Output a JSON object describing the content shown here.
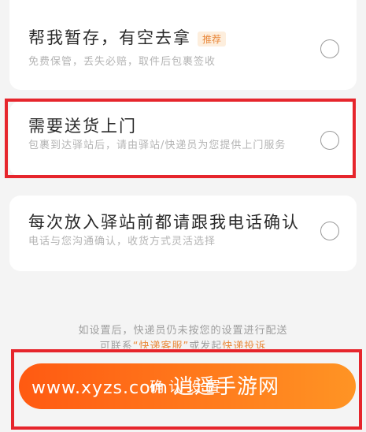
{
  "options": [
    {
      "title": "帮我暂存，有空去拿",
      "tag": "推荐",
      "desc": "免费保管，丢失必赔，取件后包裹签收",
      "selected": false
    },
    {
      "title": "需要送货上门",
      "desc": "包裹到达驿站后，请由驿站/快递员为您提供上门服务",
      "selected": false
    },
    {
      "title": "每次放入驿站前都请跟我电话确认",
      "desc": "电话与您沟通确认，收货方式灵活选择",
      "selected": false
    }
  ],
  "notice": {
    "line1": "如设置后，快递员仍未按您的设置进行配送",
    "line2_prefix": "可联系",
    "line2_emph": "“快递客服”",
    "line2_mid": "或发起",
    "line2_link": "快递投诉"
  },
  "confirm_label": "确认设置",
  "watermark": {
    "url": "www.xyzs.com",
    "name": "逍遥手游网"
  },
  "colors": {
    "accent": "#ff6a1a",
    "highlight": "#e6252c",
    "tag_bg": "#fdeedd",
    "tag_text": "#e8873a"
  }
}
